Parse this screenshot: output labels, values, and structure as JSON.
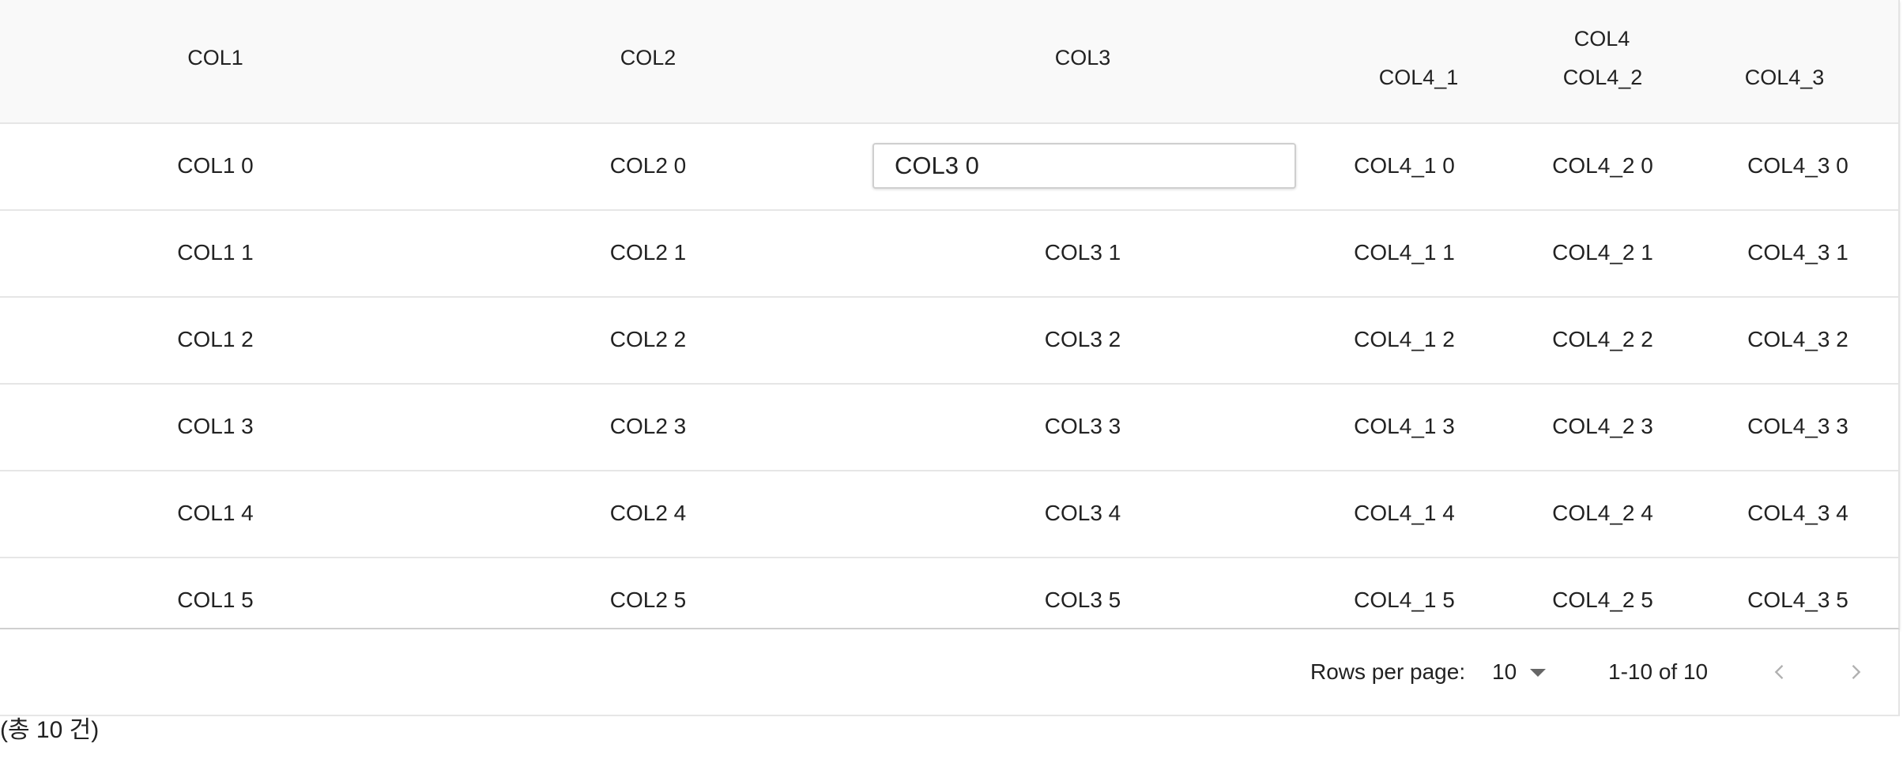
{
  "table": {
    "headers": {
      "col1": "COL1",
      "col2": "COL2",
      "col3": "COL3",
      "col4": "COL4",
      "col4_1": "COL4_1",
      "col4_2": "COL4_2",
      "col4_3": "COL4_3"
    },
    "rows": [
      [
        "COL1 0",
        "COL2 0",
        "COL3 0",
        "COL4_1 0",
        "COL4_2 0",
        "COL4_3 0"
      ],
      [
        "COL1 1",
        "COL2 1",
        "COL3 1",
        "COL4_1 1",
        "COL4_2 1",
        "COL4_3 1"
      ],
      [
        "COL1 2",
        "COL2 2",
        "COL3 2",
        "COL4_1 2",
        "COL4_2 2",
        "COL4_3 2"
      ],
      [
        "COL1 3",
        "COL2 3",
        "COL3 3",
        "COL4_1 3",
        "COL4_2 3",
        "COL4_3 3"
      ],
      [
        "COL1 4",
        "COL2 4",
        "COL3 4",
        "COL4_1 4",
        "COL4_2 4",
        "COL4_3 4"
      ],
      [
        "COL1 5",
        "COL2 5",
        "COL3 5",
        "COL4_1 5",
        "COL4_2 5",
        "COL4_3 5"
      ]
    ],
    "editing_cell_value": "COL3 0"
  },
  "pagination": {
    "rows_per_page_label": "Rows per page:",
    "rows_per_page_value": "10",
    "range_label": "1-10 of 10",
    "prev_icon": "chevron-left-icon",
    "next_icon": "chevron-right-icon"
  },
  "summary": {
    "total_label": "(총 10 건)"
  },
  "colors": {
    "header_bg": "#f9f9f9",
    "border": "#e6e6e6",
    "icon_disabled": "#b0b0b0"
  }
}
